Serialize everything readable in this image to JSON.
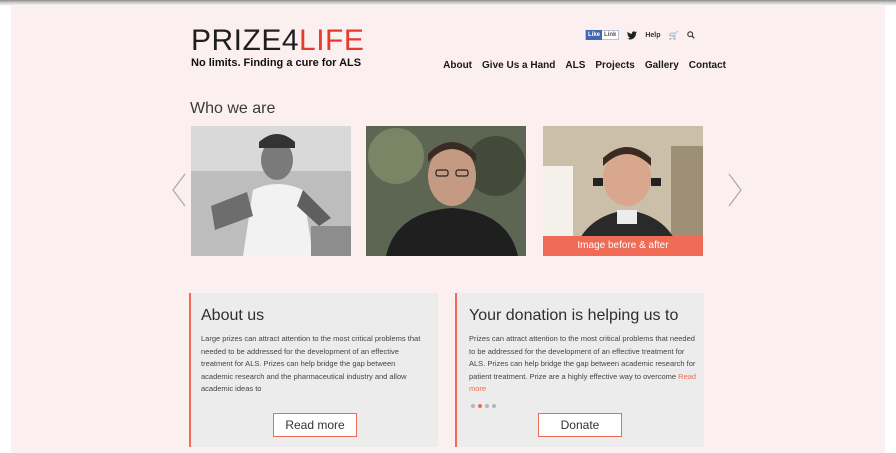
{
  "header": {
    "logo_part1": "PRIZE4",
    "logo_part2": "LIFE",
    "tagline": "No limits. Finding a cure for ALS",
    "fb_like_label": "Like",
    "fb_count": "Link",
    "help_label": "Help",
    "nav": [
      "About",
      "Give Us a Hand",
      "ALS",
      "Projects",
      "Gallery",
      "Contact"
    ]
  },
  "gallery": {
    "title": "Who we are",
    "caption": "Image before & after"
  },
  "about": {
    "title": "About us",
    "body": "Large prizes can attract attention to the most critical problems that needed to be addressed for the development of an effective treatment for ALS. Prizes can help bridge the gap between academic research and the pharmaceutical industry and allow academic ideas to",
    "button": "Read more"
  },
  "donation": {
    "title": "Your donation is helping us to",
    "body": "Prizes can attract attention to the most critical problems that needed to be addressed for the development of an effective treatment for ALS. Prizes can help bridge the gap between academic research for patient treatment. Prize are a highly effective way to overcome",
    "more_link": "Read more",
    "button": "Donate",
    "active_dot": 1
  },
  "colors": {
    "accent": "#f06b55",
    "page_bg": "#fbeff0",
    "card_bg": "#ececec",
    "logo_red": "#e63a2e"
  }
}
